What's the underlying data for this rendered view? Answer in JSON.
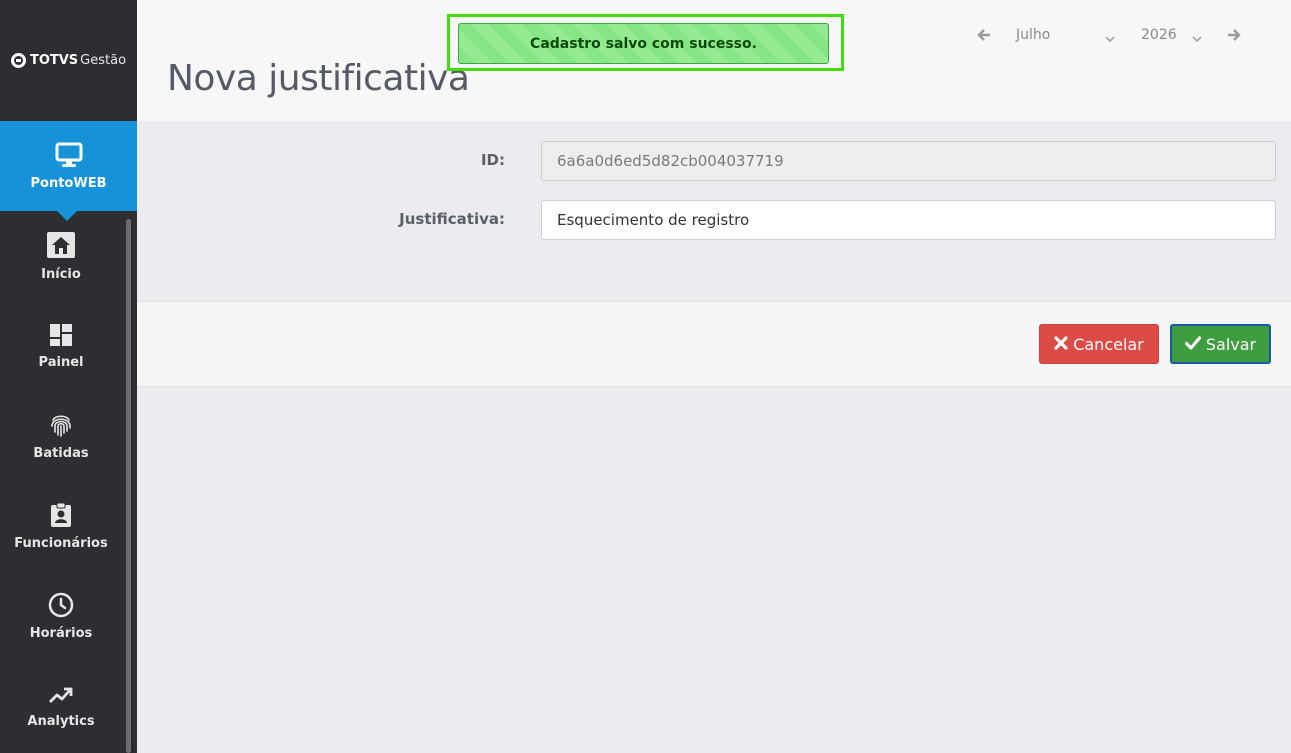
{
  "brand": {
    "logo_bold": "TOTVS",
    "logo_light": "Gestão"
  },
  "sidebar": {
    "items": [
      {
        "label": "PontoWEB",
        "icon": "monitor-icon",
        "active": true
      },
      {
        "label": "Início",
        "icon": "home-icon",
        "active": false
      },
      {
        "label": "Painel",
        "icon": "dashboard-icon",
        "active": false
      },
      {
        "label": "Batidas",
        "icon": "fingerprint-icon",
        "active": false
      },
      {
        "label": "Funcionários",
        "icon": "badge-icon",
        "active": false
      },
      {
        "label": "Horários",
        "icon": "clock-icon",
        "active": false
      },
      {
        "label": "Analytics",
        "icon": "trending-up-icon",
        "active": false
      }
    ]
  },
  "header": {
    "title": "Nova justificativa",
    "toast": "Cadastro salvo com sucesso.",
    "period": {
      "month": "Julho",
      "year": "2026"
    }
  },
  "form": {
    "id_label": "ID:",
    "id_value": "6a6a0d6ed5d82cb004037719",
    "justificativa_label": "Justificativa:",
    "justificativa_value": "Esquecimento de registro"
  },
  "actions": {
    "cancel_label": "Cancelar",
    "save_label": "Salvar"
  },
  "colors": {
    "accent": "#1592d8",
    "success": "#3d9d3f",
    "danger": "#dd4b47",
    "sidebar": "#2c2e32"
  }
}
